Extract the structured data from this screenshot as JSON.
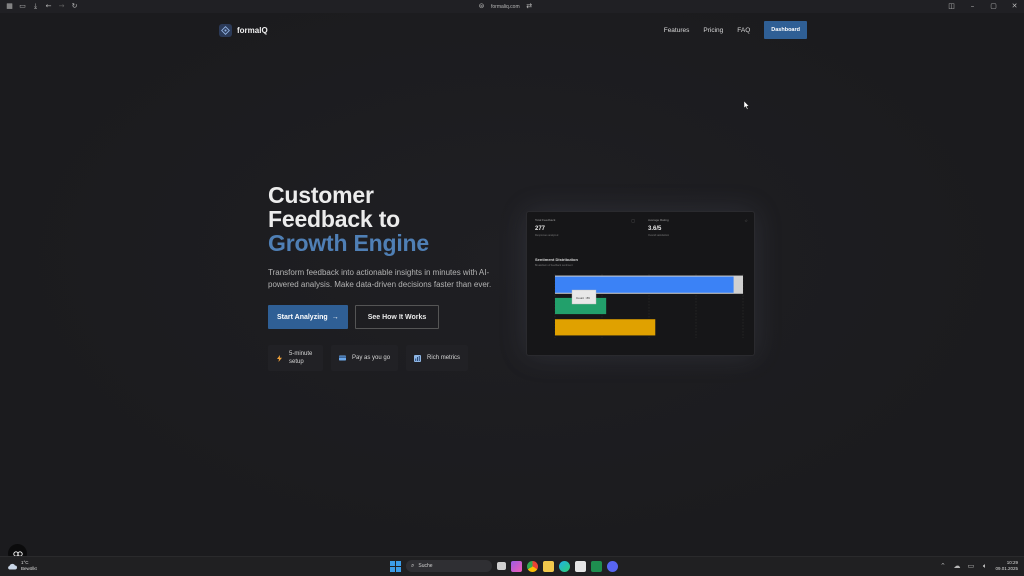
{
  "browser": {
    "url": "formaliq.com"
  },
  "nav": {
    "brand": "formalQ",
    "links": [
      "Features",
      "Pricing",
      "FAQ"
    ],
    "dashboard_label": "Dashboard"
  },
  "hero": {
    "title_line1": "Customer",
    "title_line2": "Feedback to",
    "title_accent": "Growth Engine",
    "subtitle": "Transform feedback into actionable insights in minutes with AI-powered analysis. Make data-driven decisions faster than ever.",
    "primary_cta": "Start Analyzing",
    "secondary_cta": "See How It Works",
    "features": [
      {
        "icon": "lightning-icon",
        "label": "5-minute setup"
      },
      {
        "icon": "card-icon",
        "label": "Pay as you go"
      },
      {
        "icon": "metrics-icon",
        "label": "Rich metrics"
      }
    ]
  },
  "preview": {
    "stat1": {
      "label": "Total Feedback",
      "value": "277",
      "note": "Responses analyzed"
    },
    "stat2": {
      "label": "Average Rating",
      "value": "3.6/5",
      "note": "Overall satisfaction"
    },
    "chart_title": "Sentiment Distribution",
    "chart_sub": "Breakdown of feedback sentiment",
    "tooltip": "Count : 89"
  },
  "chart_data": {
    "type": "bar",
    "orientation": "horizontal",
    "categories": [
      "",
      "",
      ""
    ],
    "values": [
      171,
      49,
      96
    ],
    "colors": [
      "#3b82f6",
      "#22a06b",
      "#e0a100"
    ],
    "xlim": [
      0,
      180
    ],
    "grid": true
  },
  "taskbar": {
    "temperature": "1°C",
    "weather": "Bewölkt",
    "search_label": "Suche",
    "time": "10:29",
    "date": "09.01.2025"
  },
  "colors": {
    "accent": "#2f5f95",
    "accent_text": "#4f7fb5",
    "background": "#1c1c1f"
  }
}
